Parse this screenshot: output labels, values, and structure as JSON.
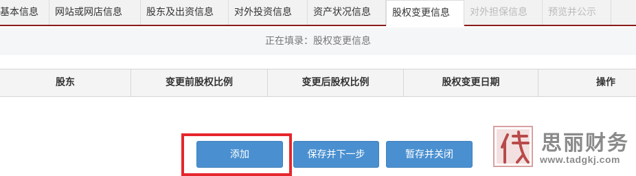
{
  "tabs": [
    {
      "label": "基本信息",
      "state": "normal"
    },
    {
      "label": "网站或网店信息",
      "state": "normal"
    },
    {
      "label": "股东及出资信息",
      "state": "normal"
    },
    {
      "label": "对外投资信息",
      "state": "normal"
    },
    {
      "label": "资产状况信息",
      "state": "normal"
    },
    {
      "label": "股权变更信息",
      "state": "active"
    },
    {
      "label": "对外担保信息",
      "state": "disabled"
    },
    {
      "label": "预览并公示",
      "state": "disabled"
    }
  ],
  "status": {
    "text": "正在填录：股权变更信息"
  },
  "table": {
    "headers": [
      "股东",
      "变更前股权比例",
      "变更后股权比例",
      "股权变更日期",
      "操作"
    ],
    "rows": []
  },
  "buttons": {
    "add": "添加",
    "save_next": "保存并下一步",
    "save_close": "暂存并关闭"
  },
  "watermark": {
    "name": "思丽财务",
    "url": "www.tadgkj.com",
    "seal_char": "代"
  },
  "colors": {
    "accent_tab_border": "#8b1a1a",
    "button_blue": "#4a90d0",
    "highlight_red": "#e5262c"
  }
}
